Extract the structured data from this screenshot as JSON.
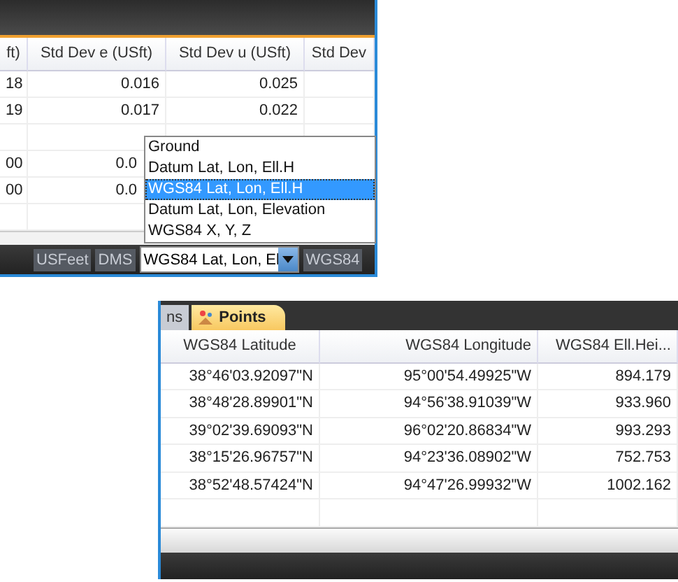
{
  "stats_window": {
    "table": {
      "columns": [
        "ft)",
        "Std Dev e (USft)",
        "Std Dev u (USft)",
        "Std Dev"
      ],
      "rows": [
        [
          "18",
          "0.016",
          "0.025",
          ""
        ],
        [
          "19",
          "0.017",
          "0.022",
          ""
        ],
        [
          "",
          "",
          "",
          ""
        ],
        [
          "00",
          "0.0"
        ],
        [
          "00",
          "0.0"
        ],
        [
          "",
          "",
          "",
          ""
        ]
      ]
    },
    "status_bar": {
      "items": [
        "USFeet",
        "DMS"
      ],
      "combo": {
        "value": "WGS84 Lat, Lon, El",
        "options": [
          {
            "label": "Ground",
            "selected": false
          },
          {
            "label": "Datum Lat, Lon, Ell.H",
            "selected": false
          },
          {
            "label": "WGS84 Lat, Lon, Ell.H",
            "selected": true
          },
          {
            "label": "Datum Lat, Lon, Elevation",
            "selected": false
          },
          {
            "label": "WGS84 X, Y, Z",
            "selected": false
          }
        ]
      },
      "trailing": "WGS84"
    }
  },
  "points_window": {
    "tabs": [
      {
        "label": "ns",
        "selected": false,
        "kind": "plain"
      },
      {
        "label": "Points",
        "selected": true,
        "kind": "points"
      }
    ],
    "table": {
      "columns": [
        "WGS84 Latitude",
        "WGS84 Longitude",
        "WGS84 Ell.Hei..."
      ],
      "rows": [
        [
          "38°46'03.92097\"N",
          "95°00'54.49925\"W",
          "894.179"
        ],
        [
          "38°48'28.89901\"N",
          "94°56'38.91039\"W",
          "933.960"
        ],
        [
          "39°02'39.69093\"N",
          "96°02'20.86834\"W",
          "993.293"
        ],
        [
          "38°15'26.96757\"N",
          "94°23'36.08902\"W",
          "752.753"
        ],
        [
          "38°52'48.57424\"N",
          "94°47'26.99932\"W",
          "1002.162"
        ],
        [
          "",
          "",
          ""
        ]
      ]
    }
  }
}
